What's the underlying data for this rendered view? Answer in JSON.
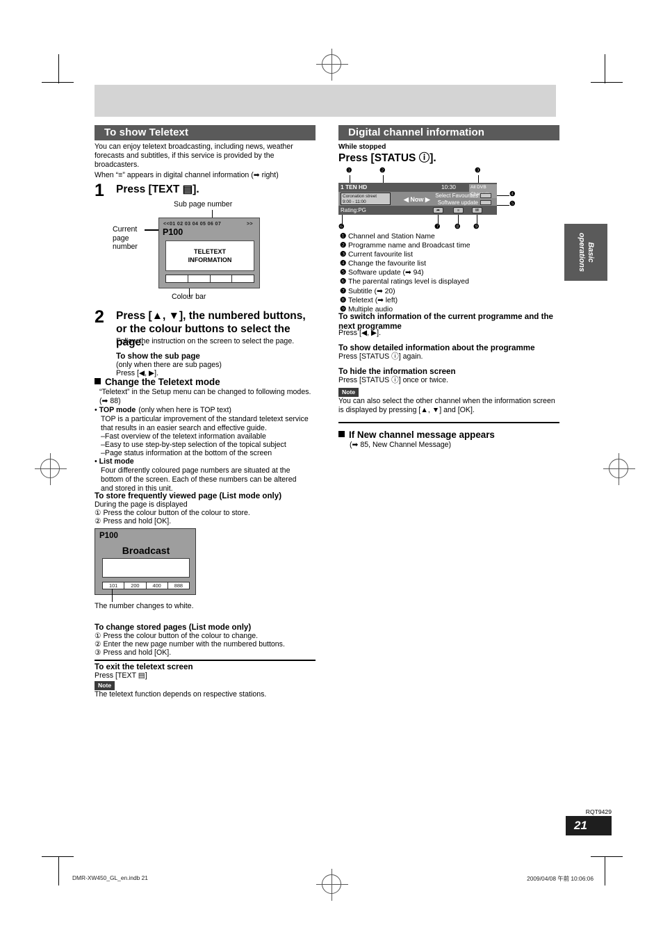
{
  "left": {
    "section_title": "To show Teletext",
    "intro": "You can enjoy teletext broadcasting, including news, weather forecasts and subtitles, if this service is provided by the broadcasters.",
    "when_line": "When “≡” appears in digital channel information (➡ right)",
    "step1_no": "1",
    "step1_text": "Press [TEXT ▤].",
    "label_subpage": "Sub page number",
    "label_current_page": "Current\npage\nnumber",
    "label_colour_bar": "Colour bar",
    "teletext_screen": {
      "sub_numbers": "<<01 02 03 04 05 06 07",
      "arrows": ">>",
      "page": "P100",
      "body_line1": "TELETEXT",
      "body_line2": "INFORMATION"
    },
    "step2_no": "2",
    "step2_text": "Press [▲, ▼], the numbered buttons, or the colour buttons to select the page.",
    "step2_sub": "Follow the instruction on the screen to select the page.",
    "subpage_head": "To show the sub page",
    "subpage_note": "(only when there are sub pages)",
    "subpage_press": "Press [◀, ▶].",
    "change_mode_head": "Change the Teletext mode",
    "change_mode_intro": "“Teletext” in the Setup menu can be changed to following modes. (➡ 88)",
    "top_mode_head": "TOP mode",
    "top_mode_paren": "(only when here is TOP text)",
    "top_mode_desc": "TOP is a particular improvement of the standard teletext service that results in an easier search and effective guide.",
    "top_mode_b1": "–Fast overview of the teletext information available",
    "top_mode_b2": "–Easy to use step-by-step selection of the topical subject",
    "top_mode_b3": "–Page status information at the bottom of the screen",
    "list_mode_head": "List mode",
    "list_mode_desc": "Four differently coloured page numbers are situated at the bottom of the screen. Each of these numbers can be altered and stored in this unit.",
    "store_head": "To store frequently viewed page (List mode only)",
    "store_l1": "During the page is displayed",
    "store_l2": "① Press the colour button of the colour to store.",
    "store_l3": "② Press and hold [OK].",
    "broadcast_screen": {
      "page": "P100",
      "title": "Broadcast",
      "numbers": [
        "101",
        "200",
        "400",
        "888"
      ]
    },
    "white_note": "The number changes to white.",
    "change_head": "To change stored pages (List mode only)",
    "change_l1": "① Press the colour button of the colour to change.",
    "change_l2": "② Enter the new page number with the numbered buttons.",
    "change_l3": "③ Press and hold [OK].",
    "exit_head": "To exit the teletext screen",
    "exit_press": "Press [TEXT ▤]",
    "note_tag": "Note",
    "note_text": "The teletext function depends on respective stations."
  },
  "right": {
    "section_title": "Digital channel information",
    "while_stopped": "While stopped",
    "press_status": "Press [STATUS ⓘ].",
    "callouts_top": [
      "❶",
      "❷",
      "❸"
    ],
    "callouts_side": [
      "❹",
      "❺"
    ],
    "callouts_bottom": [
      "❻",
      "❼",
      "❽",
      "❾"
    ],
    "osd": {
      "channel": "1 TEN HD",
      "time": "10:30",
      "dvb": "All DVB Channels",
      "programme": "Coronation street",
      "programme_time": "9:00 - 11:00",
      "now": "◀ Now ▶",
      "select_favourites": "Select Favourites",
      "software_update": "Software update",
      "rating": "Rating:PG",
      "icon_subtitle": "➦",
      "icon_teletext": "≡",
      "icon_audio": "I/I"
    },
    "features": [
      {
        "num": "❶",
        "text": "Channel and Station Name"
      },
      {
        "num": "❷",
        "text": "Programme name and Broadcast time"
      },
      {
        "num": "❸",
        "text": "Current favourite list"
      },
      {
        "num": "❹",
        "text": "Change the favourite list"
      },
      {
        "num": "❺",
        "text": "Software update (➡ 94)"
      },
      {
        "num": "❻",
        "text": "The parental ratings level is displayed"
      },
      {
        "num": "❼",
        "text": "Subtitle (➡ 20)"
      },
      {
        "num": "❽",
        "text": "Teletext (➡ left)"
      },
      {
        "num": "❾",
        "text": "Multiple audio"
      }
    ],
    "switch_head": "To switch information of the current programme and the next programme",
    "switch_press": "Press [◀, ▶].",
    "detail_head": "To show detailed information about the programme",
    "detail_press": "Press [STATUS ⓘ] again.",
    "hide_head": "To hide the information screen",
    "hide_press": "Press [STATUS ⓘ] once or twice.",
    "note_tag": "Note",
    "note_text": "You can also select the other channel when the information screen is displayed by pressing [▲, ▼] and [OK].",
    "newchan_head": "If New channel message appears",
    "newchan_ref": "(➡ 85, New Channel Message)"
  },
  "side_tab": "Basic\noperations",
  "footer": {
    "rqt": "RQT9429",
    "page_number": "21",
    "file_line": "DMR-XW450_GL_en.indb   21",
    "timestamp": "2009/04/08   午前 10:06:06"
  }
}
